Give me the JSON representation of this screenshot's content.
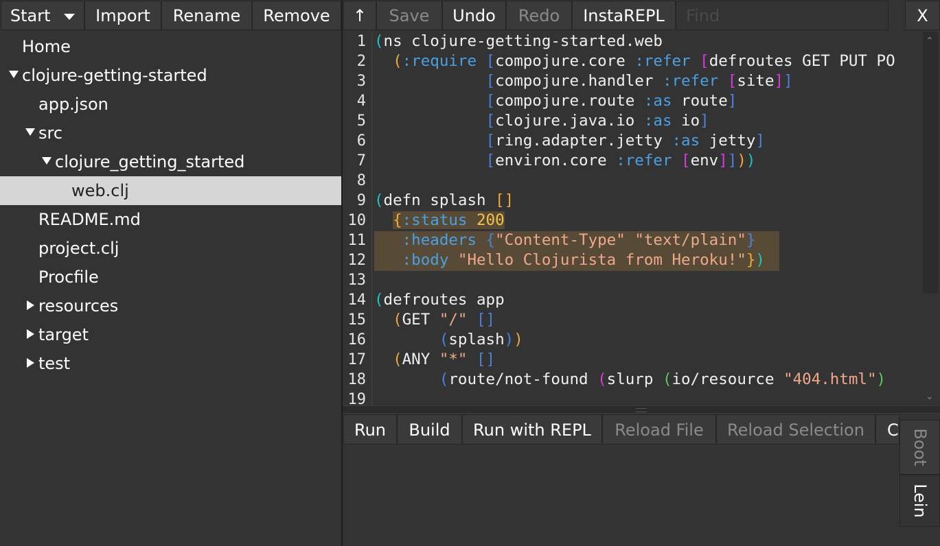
{
  "left_toolbar": {
    "start_label": "Start",
    "import_label": "Import",
    "rename_label": "Rename",
    "remove_label": "Remove"
  },
  "tree": {
    "home": "Home",
    "project": "clojure-getting-started",
    "app_json": "app.json",
    "src": "src",
    "pkg": "clojure_getting_started",
    "web_clj": "web.clj",
    "readme": "README.md",
    "project_clj": "project.clj",
    "procfile": "Procfile",
    "resources": "resources",
    "target": "target",
    "test": "test"
  },
  "editor_toolbar": {
    "up_label": "↑",
    "save_label": "Save",
    "undo_label": "Undo",
    "redo_label": "Redo",
    "instarepl_label": "InstaREPL",
    "find_placeholder": "Find",
    "close_label": "X"
  },
  "editor": {
    "line_numbers": [
      "1",
      "2",
      "3",
      "4",
      "5",
      "6",
      "7",
      "8",
      "9",
      "10",
      "11",
      "12",
      "13",
      "14",
      "15",
      "16",
      "17",
      "18",
      "19"
    ]
  },
  "bottom_toolbar": {
    "run_label": "Run",
    "build_label": "Build",
    "run_repl_label": "Run with REPL",
    "reload_file_label": "Reload File",
    "reload_selection_label": "Reload Selection",
    "clear_label": "C"
  },
  "build_tabs": {
    "boot_label": "Boot",
    "lein_label": "Lein"
  },
  "colors": {
    "background": "#333333",
    "selected_row": "#d6d6d6",
    "highlight_bg": "#574b38",
    "paren_cyan": "#19c6c6",
    "paren_orange": "#f3a83a",
    "paren_blue": "#4d7fd8",
    "keyword": "#4aa0e0",
    "string": "#f0a88a",
    "number": "#f5c14a"
  }
}
